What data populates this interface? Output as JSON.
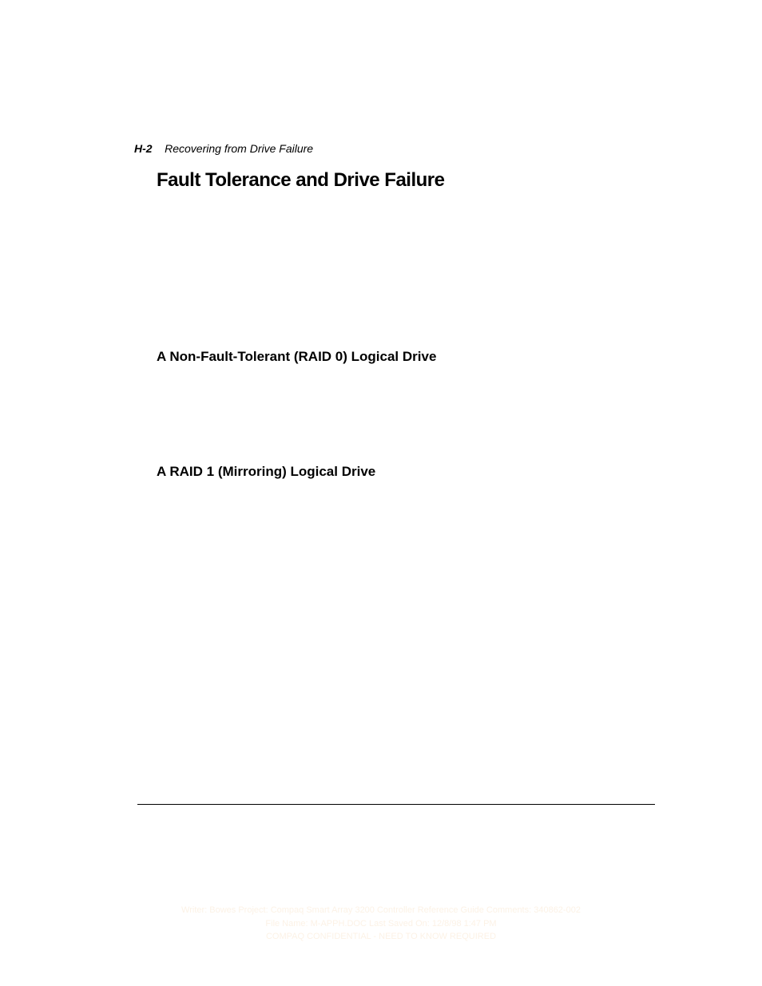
{
  "header": {
    "page_number": "H-2",
    "chapter_title": "Recovering from Drive Failure"
  },
  "section": {
    "title": "Fault Tolerance and Drive Failure"
  },
  "subsections": [
    {
      "title": "A Non-Fault-Tolerant (RAID 0) Logical Drive"
    },
    {
      "title": "A RAID 1 (Mirroring) Logical Drive"
    }
  ],
  "footer": {
    "line1": "Writer: Bowes   Project: Compaq Smart Array 3200 Controller Reference Guide   Comments: 340862-002",
    "line2": "File Name: M-APPH.DOC   Last Saved On: 12/8/98 1:47 PM",
    "line3": "COMPAQ CONFIDENTIAL - NEED TO KNOW REQUIRED"
  }
}
